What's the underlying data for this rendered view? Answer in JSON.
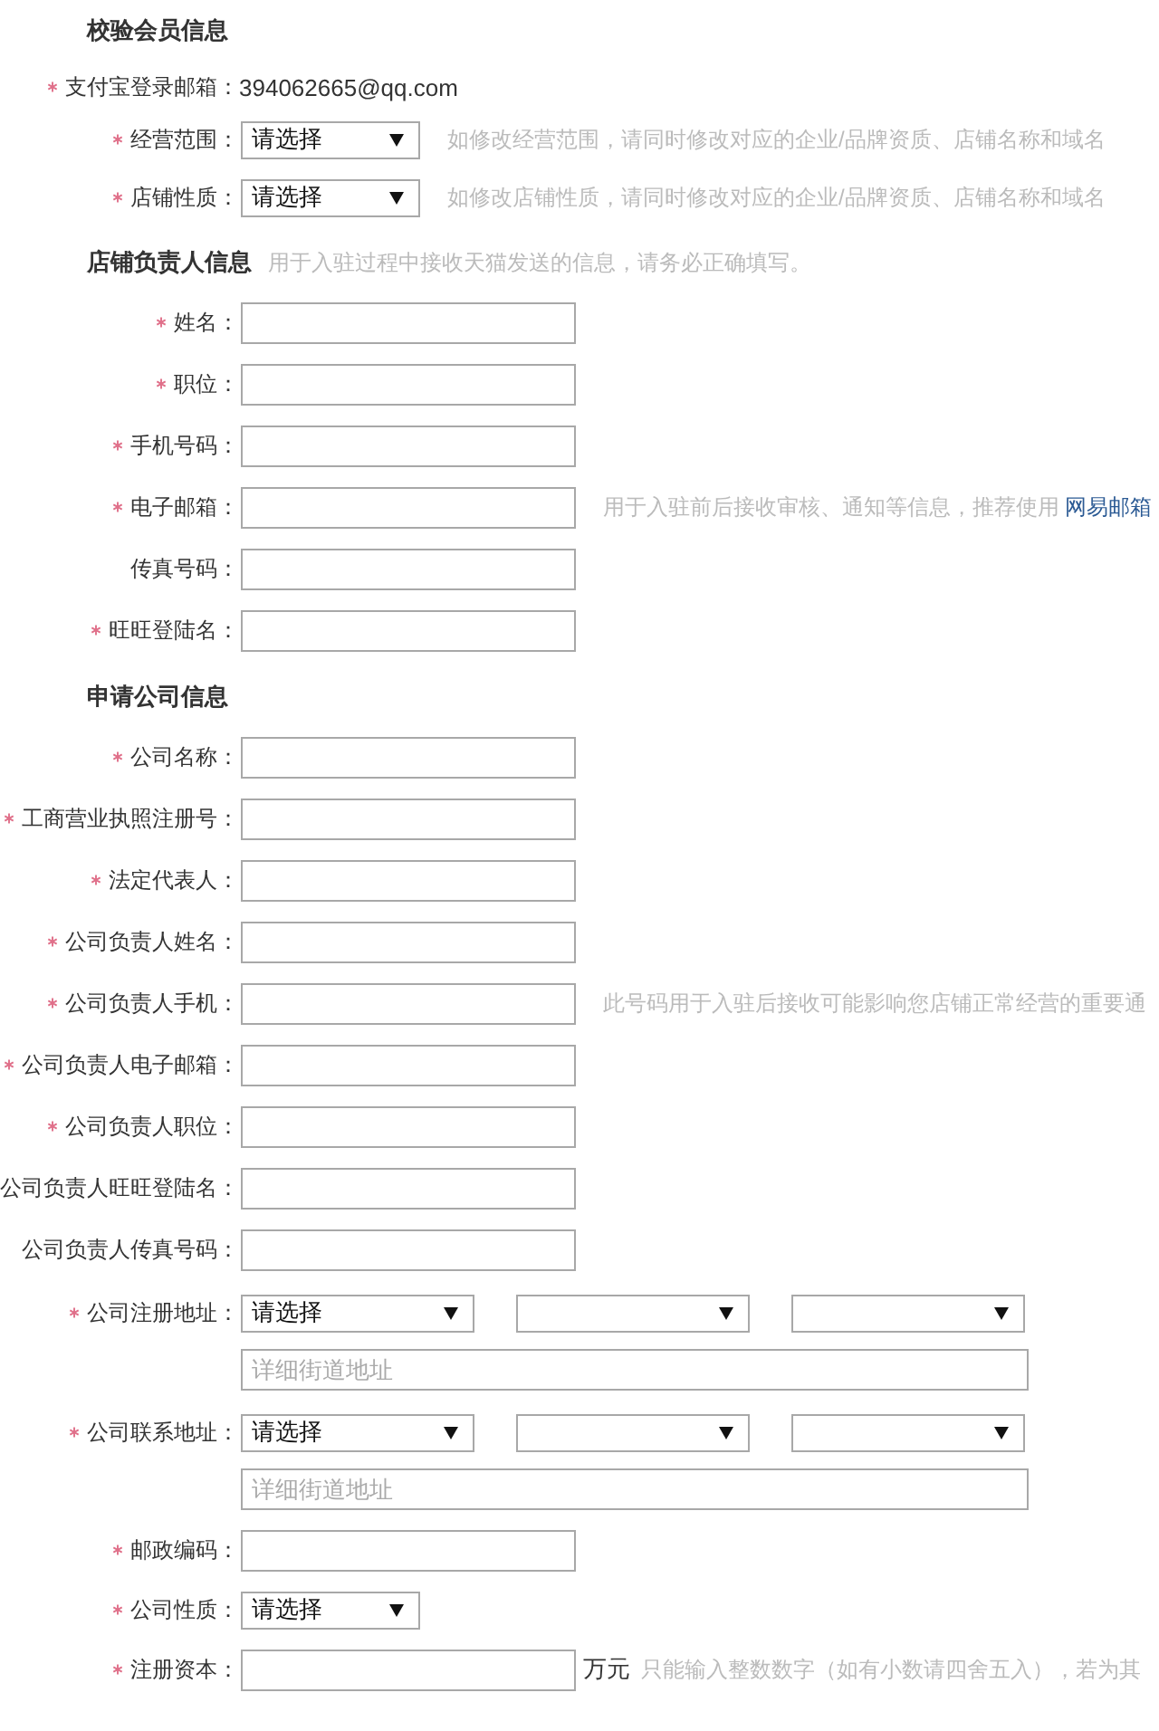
{
  "sections": [
    {
      "title": "校验会员信息",
      "rows": [
        {
          "kind": "text",
          "required": true,
          "label": "支付宝登录邮箱：",
          "value": "394062665@qq.com"
        },
        {
          "kind": "select",
          "required": true,
          "label": "经营范围：",
          "dropdowns": [
            {
              "kind": "choice",
              "value": "请选择"
            }
          ],
          "hint": "如修改经营范围，请同时修改对应的企业/品牌资质、店铺名称和域名"
        },
        {
          "kind": "select",
          "required": true,
          "label": "店铺性质：",
          "dropdowns": [
            {
              "kind": "choice",
              "value": "请选择"
            }
          ],
          "hint": "如修改店铺性质，请同时修改对应的企业/品牌资质、店铺名称和域名"
        }
      ]
    },
    {
      "title": "店铺负责人信息",
      "note": "用于入驻过程中接收天猫发送的信息，请务必正确填写。",
      "rows": [
        {
          "kind": "input",
          "required": true,
          "label": "姓名："
        },
        {
          "kind": "input",
          "required": true,
          "label": "职位："
        },
        {
          "kind": "input",
          "required": true,
          "label": "手机号码："
        },
        {
          "kind": "input",
          "required": true,
          "label": "电子邮箱：",
          "hint": "用于入驻前后接收审核、通知等信息，推荐使用",
          "hint_link": "网易邮箱"
        },
        {
          "kind": "input",
          "required": false,
          "label": "传真号码："
        },
        {
          "kind": "input",
          "required": true,
          "label": "旺旺登陆名："
        }
      ]
    },
    {
      "title": "申请公司信息",
      "rows": [
        {
          "kind": "input",
          "required": true,
          "label": "公司名称："
        },
        {
          "kind": "input",
          "required": true,
          "label": "工商营业执照注册号："
        },
        {
          "kind": "input",
          "required": true,
          "label": "法定代表人："
        },
        {
          "kind": "input",
          "required": true,
          "label": "公司负责人姓名："
        },
        {
          "kind": "input",
          "required": true,
          "label": "公司负责人手机：",
          "hint": "此号码用于入驻后接收可能影响您店铺正常经营的重要通"
        },
        {
          "kind": "input",
          "required": true,
          "label": "公司负责人电子邮箱："
        },
        {
          "kind": "input",
          "required": true,
          "label": "公司负责人职位："
        },
        {
          "kind": "input",
          "required": false,
          "label": "公司负责人旺旺登陆名："
        },
        {
          "kind": "input",
          "required": false,
          "label": "公司负责人传真号码："
        },
        {
          "kind": "address",
          "required": true,
          "label": "公司注册地址：",
          "dropdowns": [
            {
              "kind": "choice",
              "value": "请选择"
            },
            {
              "kind": "blank"
            },
            {
              "kind": "blank"
            }
          ],
          "street": {
            "placeholder": "详细街道地址"
          }
        },
        {
          "kind": "address",
          "required": true,
          "label": "公司联系地址：",
          "dropdowns": [
            {
              "kind": "choice",
              "value": "请选择"
            },
            {
              "kind": "blank"
            },
            {
              "kind": "blank"
            }
          ],
          "street": {
            "placeholder": "详细街道地址"
          }
        },
        {
          "kind": "input",
          "required": true,
          "label": "邮政编码："
        },
        {
          "kind": "select",
          "required": true,
          "label": "公司性质：",
          "dropdowns": [
            {
              "kind": "choice",
              "value": "请选择"
            }
          ]
        },
        {
          "kind": "input",
          "required": true,
          "label": "注册资本：",
          "unit": "万元",
          "hint": "只能输入整数数字（如有小数请四舍五入），若为其"
        }
      ]
    }
  ]
}
